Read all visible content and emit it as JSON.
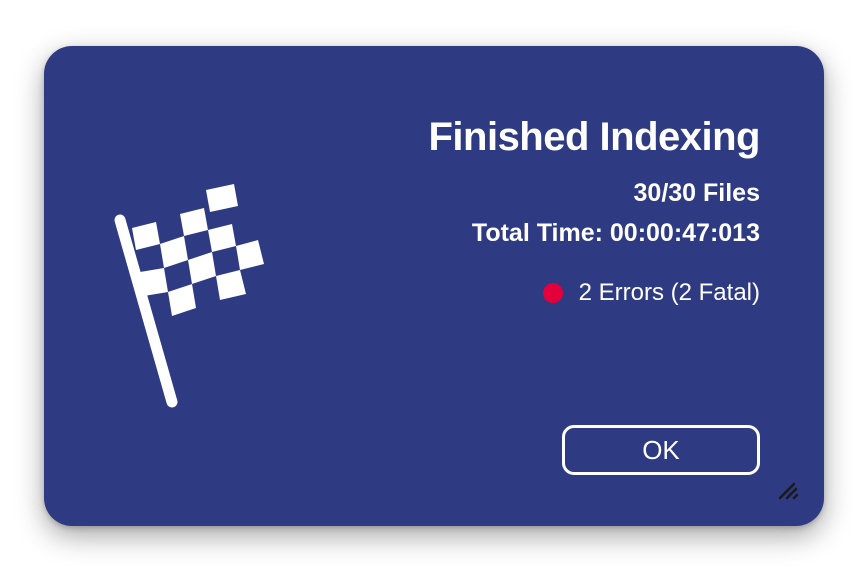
{
  "dialog": {
    "title": "Finished Indexing",
    "files": "30/30 Files",
    "total_time": "Total Time: 00:00:47:013",
    "errors": {
      "label": "2 Errors (2 Fatal)",
      "status_color": "#e4003a"
    },
    "ok_label": "OK",
    "background_color": "#2e3a82",
    "icons": {
      "main": "checkered-flag-icon",
      "status": "red-dot-icon",
      "grip": "resize-grip-icon"
    }
  }
}
